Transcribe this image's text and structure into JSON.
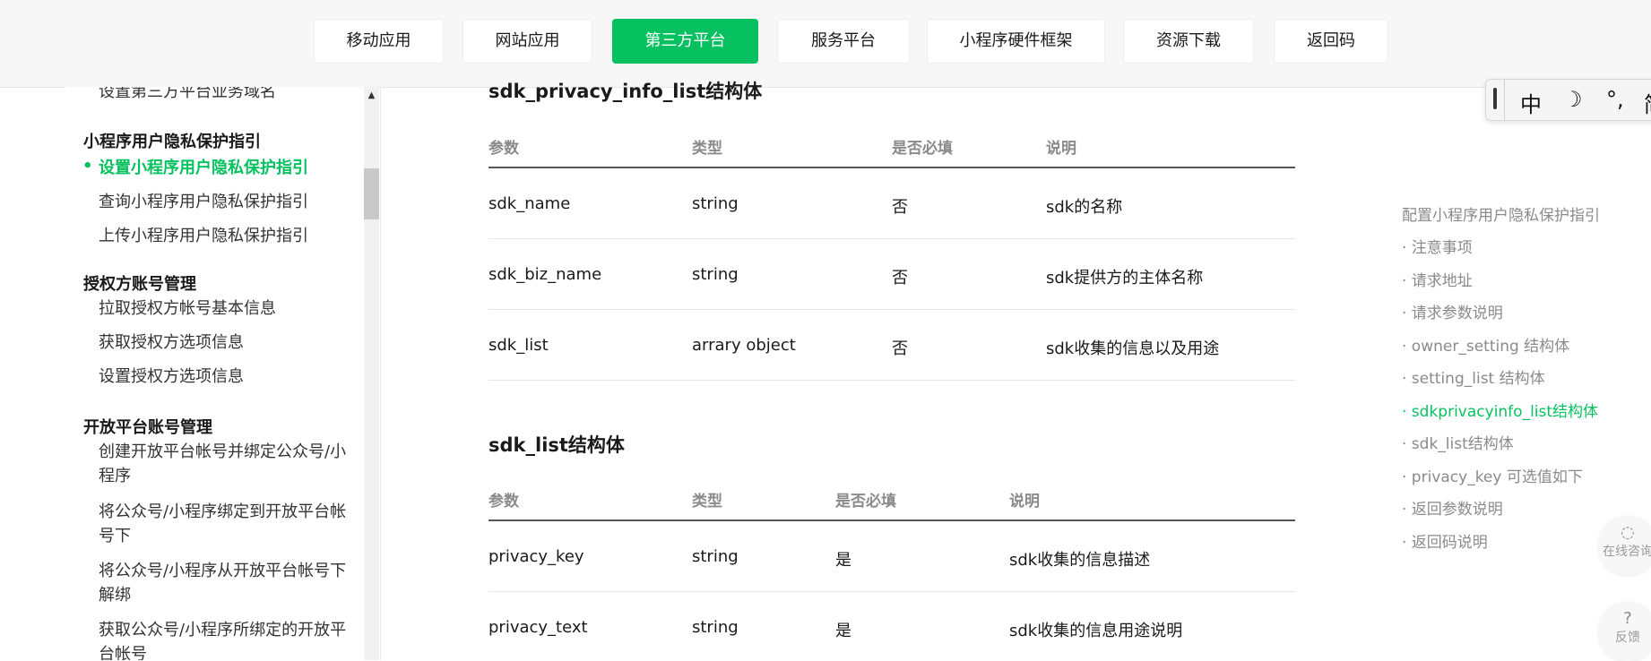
{
  "nav": {
    "items": [
      "移动应用",
      "网站应用",
      "第三方平台",
      "服务平台",
      "小程序硬件框架",
      "资源下载",
      "返回码"
    ],
    "active_index": 2
  },
  "sidebar": {
    "truncated_top": "设置第三方平台业务域名",
    "groups": [
      {
        "title": "小程序用户隐私保护指引",
        "items": [
          "设置小程序用户隐私保护指引",
          "查询小程序用户隐私保护指引",
          "上传小程序用户隐私保护指引"
        ]
      },
      {
        "title": "授权方账号管理",
        "items": [
          "拉取授权方帐号基本信息",
          "获取授权方选项信息",
          "设置授权方选项信息"
        ]
      },
      {
        "title": "开放平台账号管理",
        "items": [
          "创建开放平台帐号并绑定公众号/小程序",
          "将公众号/小程序绑定到开放平台帐号下",
          "将公众号/小程序从开放平台帐号下解绑",
          "获取公众号/小程序所绑定的开放平台帐号"
        ]
      }
    ]
  },
  "main": {
    "table1": {
      "title": "sdk_privacy_info_list结构体",
      "headers": [
        "参数",
        "类型",
        "是否必填",
        "说明"
      ],
      "rows": [
        [
          "sdk_name",
          "string",
          "否",
          "sdk的名称"
        ],
        [
          "sdk_biz_name",
          "string",
          "否",
          "sdk提供方的主体名称"
        ],
        [
          "sdk_list",
          "arrary object",
          "否",
          "sdk收集的信息以及用途"
        ]
      ]
    },
    "table2": {
      "title": "sdk_list结构体",
      "headers": [
        "参数",
        "类型",
        "是否必填",
        "说明"
      ],
      "rows": [
        [
          "privacy_key",
          "string",
          "是",
          "sdk收集的信息描述"
        ],
        [
          "privacy_text",
          "string",
          "是",
          "sdk收集的信息用途说明"
        ]
      ]
    }
  },
  "toc": {
    "title": "配置小程序用户隐私保护指引",
    "items": [
      "· 注意事项",
      "· 请求地址",
      "· 请求参数说明",
      "· owner_setting 结构体",
      "· setting_list 结构体",
      "· sdkprivacyinfo_list结构体",
      "· sdk_list结构体",
      "· privacy_key 可选值如下",
      "· 返回参数说明",
      "· 返回码说明"
    ],
    "active_index": 5
  },
  "ime": {
    "glyphs": [
      "中",
      "☽",
      "°,",
      "简"
    ]
  },
  "float": {
    "consult_label": "在线咨询",
    "feedback_label": "反馈"
  },
  "colors": {
    "accent": "#07c160",
    "muted": "#8a8a8a"
  }
}
